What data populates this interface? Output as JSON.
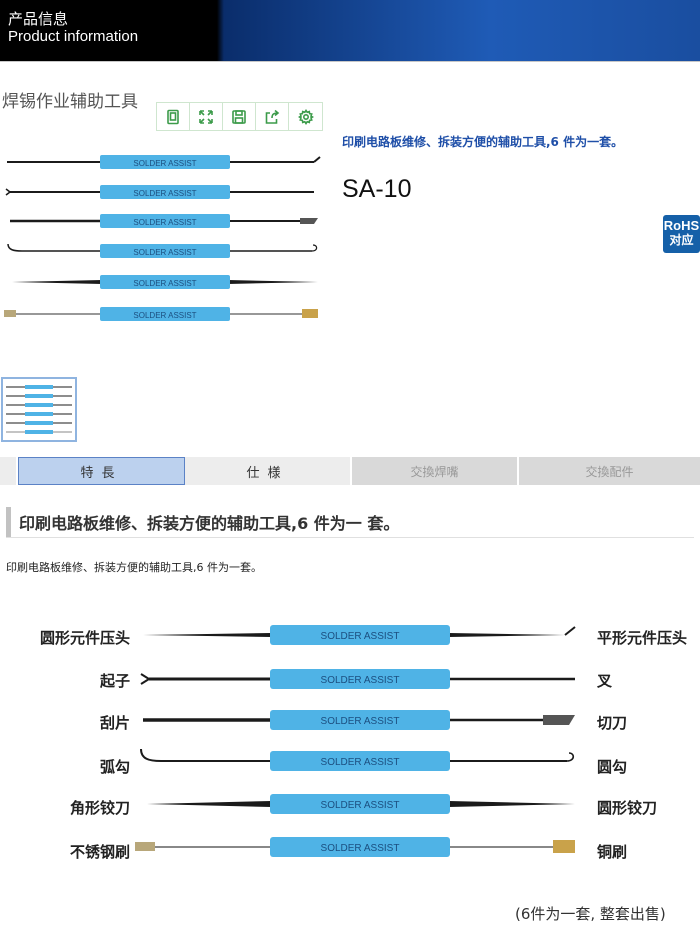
{
  "header": {
    "title_cn": "产品信息",
    "title_en": "Product information"
  },
  "product": {
    "title": "焊锡作业辅助工具",
    "description": "印刷电路板维修、拆装方便的辅助工具,6 件为一套。",
    "model": "SA-10",
    "rohs_line1": "RoHS",
    "rohs_line2": "对应",
    "handle_text": "SOLDER ASSIST"
  },
  "toolbar": {
    "icons": [
      "copy-icon",
      "expand-icon",
      "save-icon",
      "share-icon",
      "settings-icon"
    ]
  },
  "tabs": [
    {
      "label": "特長",
      "active": true
    },
    {
      "label": "仕様",
      "active": false
    },
    {
      "label": "交換焊嘴",
      "active": false,
      "disabled": true
    },
    {
      "label": "交換配件",
      "active": false,
      "disabled": true
    }
  ],
  "feature": {
    "heading": "印刷电路板维修、拆装方便的辅助工具,6 件为一 套。",
    "text": "印刷电路板维修、拆装方便的辅助工具,6 件为一套。"
  },
  "tools": [
    {
      "left": "圆形元件压头",
      "right": "平形元件压头"
    },
    {
      "left": "起子",
      "right": "叉"
    },
    {
      "left": "刮片",
      "right": "切刀"
    },
    {
      "left": "弧勾",
      "right": "圆勾"
    },
    {
      "left": "角形铰刀",
      "right": "圆形铰刀"
    },
    {
      "left": "不锈钢刷",
      "right": "铜刷"
    }
  ],
  "set_note": "(6件为一套, 整套出售)",
  "colors": {
    "handle": "#4fb3e6",
    "accent_text": "#1f4fa8",
    "rohs_bg": "#1560a8",
    "toolbar_icon": "#3c9b4a"
  }
}
